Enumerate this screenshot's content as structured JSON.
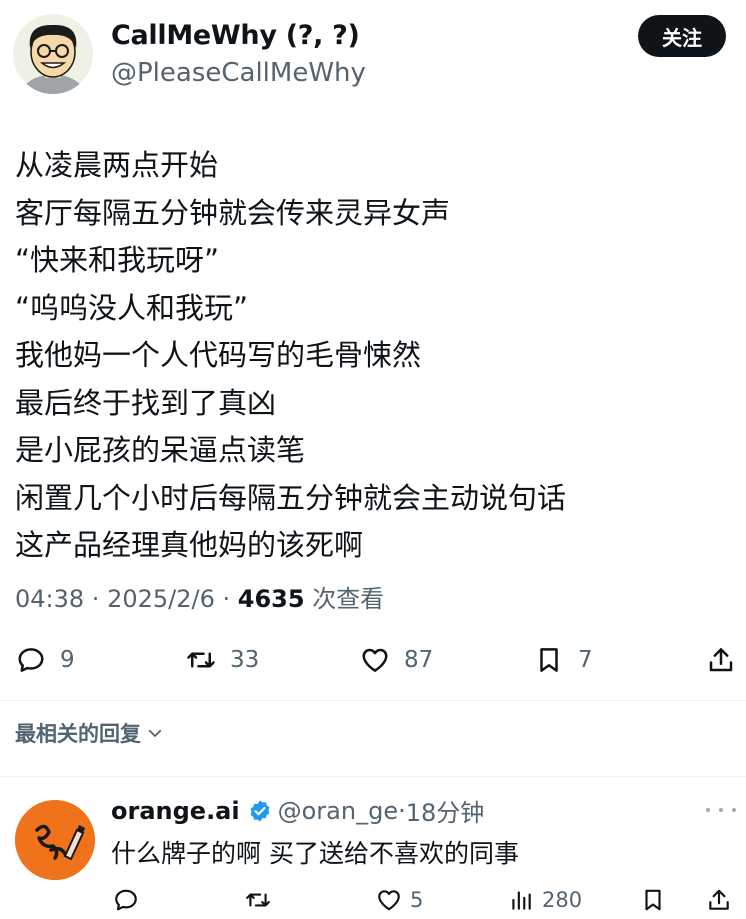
{
  "tweet": {
    "author_name": "CallMeWhy (?, ?)",
    "author_handle": "@PleaseCallMeWhy",
    "follow_label": "关注",
    "lines": [
      "从凌晨两点开始",
      "客厅每隔五分钟就会传来灵异女声",
      "“快来和我玩呀”",
      "“呜呜没人和我玩”",
      "我他妈一个人代码写的毛骨悚然",
      "最后终于找到了真凶",
      "是小屁孩的呆逼点读笔",
      "闲置几个小时后每隔五分钟就会主动说句话",
      "这产品经理真他妈的该死啊"
    ],
    "time": "04:38",
    "date": "2025/2/6",
    "views": "4635",
    "views_label": "次查看",
    "replies": "9",
    "retweets": "33",
    "likes": "87",
    "bookmarks": "7"
  },
  "replies_sort_label": "最相关的回复",
  "reply": {
    "name": "orange.ai",
    "handle": "@oran_ge",
    "time": "18分钟",
    "text": "什么牌子的啊 买了送给不喜欢的同事",
    "likes": "5",
    "views": "280"
  },
  "colors": {
    "text": "#0f1419",
    "secondary": "#536471",
    "verified": "#1d9bf0",
    "reply_avatar": "#f0731c"
  },
  "icons": [
    "reply-icon",
    "retweet-icon",
    "like-icon",
    "bookmark-icon",
    "share-icon",
    "views-icon",
    "verified-badge-icon",
    "more-icon",
    "chevron-down-icon"
  ]
}
